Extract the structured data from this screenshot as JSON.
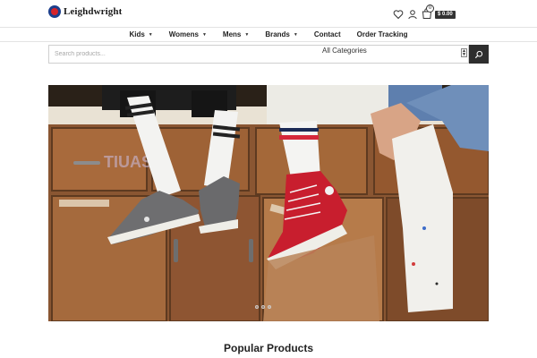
{
  "brand": {
    "name": "Leighdwright"
  },
  "header": {
    "cart_count": "0",
    "cart_total": "$ 0.00"
  },
  "nav": {
    "items": [
      {
        "label": "Kids",
        "dropdown": true
      },
      {
        "label": "Womens",
        "dropdown": true
      },
      {
        "label": "Mens",
        "dropdown": true
      },
      {
        "label": "Brands",
        "dropdown": true
      },
      {
        "label": "Contact",
        "dropdown": false
      },
      {
        "label": "Order Tracking",
        "dropdown": false
      }
    ]
  },
  "search": {
    "placeholder": "Search products...",
    "category_selected": "All Categories"
  },
  "hero": {
    "slides_total": 3,
    "active_slide": 1
  },
  "sections": {
    "popular_title": "Popular Products"
  },
  "colors": {
    "accent_dark": "#2e2e2e",
    "logo_blue": "#1c3f8c",
    "logo_red": "#d6232a"
  },
  "icons": {
    "wishlist": "heart-icon",
    "account": "user-icon",
    "cart": "shopping-bag-icon",
    "search": "search-icon"
  }
}
